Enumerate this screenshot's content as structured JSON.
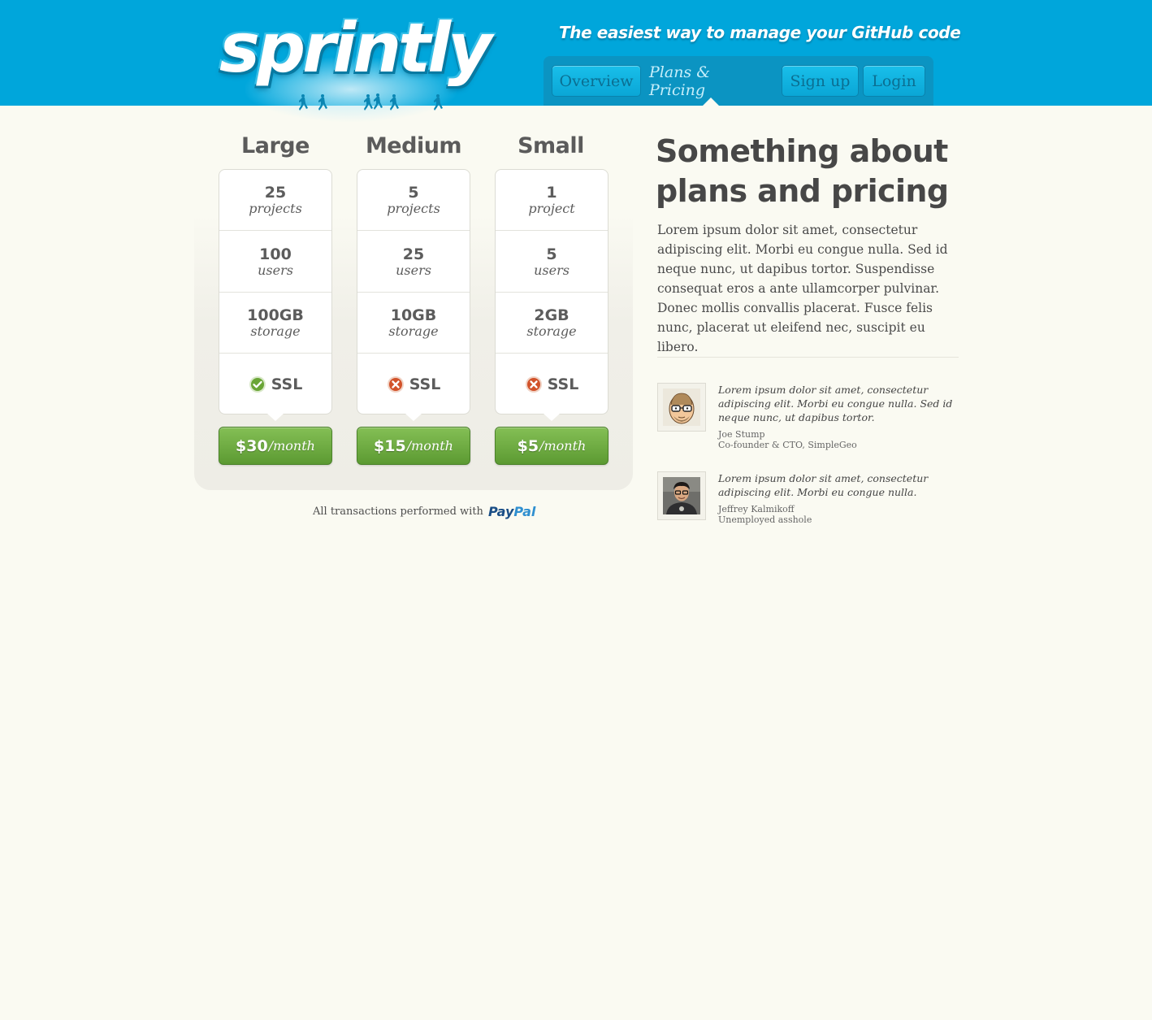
{
  "brand": {
    "logo_text": "sprintly",
    "tagline": "The easiest way to manage your GitHub code"
  },
  "nav": {
    "items": [
      {
        "label": "Overview",
        "active": false
      },
      {
        "label": "Plans & Pricing",
        "active": true
      },
      {
        "label": "Sign up",
        "active": false
      },
      {
        "label": "Login",
        "active": false
      }
    ]
  },
  "plans": [
    {
      "name": "Large",
      "projects": "25",
      "projects_unit": "projects",
      "users": "100",
      "users_unit": "users",
      "storage": "100GB",
      "storage_unit": "storage",
      "ssl_label": "SSL",
      "ssl_included": true,
      "price": "$30",
      "period": "/month"
    },
    {
      "name": "Medium",
      "projects": "5",
      "projects_unit": "projects",
      "users": "25",
      "users_unit": "users",
      "storage": "10GB",
      "storage_unit": "storage",
      "ssl_label": "SSL",
      "ssl_included": false,
      "price": "$15",
      "period": "/month"
    },
    {
      "name": "Small",
      "projects": "1",
      "projects_unit": "project",
      "users": "5",
      "users_unit": "users",
      "storage": "2GB",
      "storage_unit": "storage",
      "ssl_label": "SSL",
      "ssl_included": false,
      "price": "$5",
      "period": "/month"
    }
  ],
  "payment": {
    "note": "All transactions performed with",
    "provider_a": "Pay",
    "provider_b": "Pal"
  },
  "about": {
    "heading": "Something about plans and pricing",
    "body": "Lorem ipsum dolor sit amet, consectetur adipiscing elit. Morbi eu congue nulla. Sed id neque nunc, ut dapibus tortor. Suspendisse consequat eros a ante ullamcorper pulvinar. Donec mollis convallis placerat. Fusce felis nunc, placerat ut eleifend nec, suscipit eu libero."
  },
  "testimonials": [
    {
      "quote": "Lorem ipsum dolor sit amet, consectetur adipiscing elit. Morbi eu congue nulla. Sed id neque nunc, ut dapibus tortor.",
      "name": "Joe Stump",
      "title": "Co-founder & CTO, SimpleGeo"
    },
    {
      "quote": "Lorem ipsum dolor sit amet, consectetur adipiscing elit. Morbi eu congue nulla.",
      "name": "Jeffrey Kalmikoff",
      "title": "Unemployed asshole"
    }
  ],
  "colors": {
    "header": "#00a6db",
    "page_bg": "#fafaf2",
    "price_button": "#6ba940",
    "ssl_yes": "#6aa536",
    "ssl_no": "#d2522a"
  }
}
